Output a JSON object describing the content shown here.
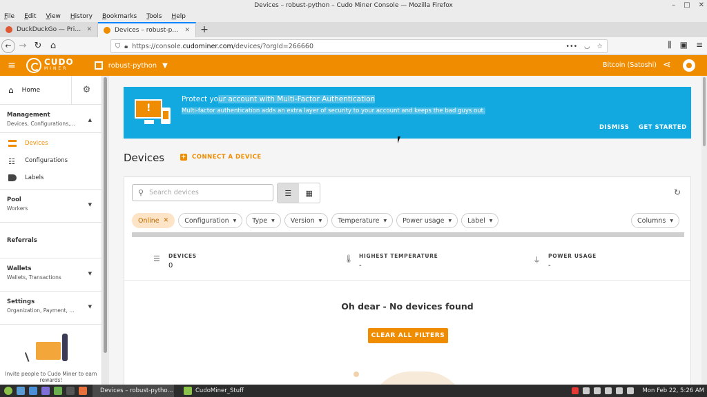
{
  "window": {
    "title": "Devices – robust-python – Cudo Miner Console — Mozilla Firefox",
    "controls": [
      "–",
      "□",
      "✕"
    ]
  },
  "menubar": [
    "File",
    "Edit",
    "View",
    "History",
    "Bookmarks",
    "Tools",
    "Help"
  ],
  "tabs": [
    {
      "label": "DuckDuckGo — Privacy, sim",
      "favicon_color": "#de5833",
      "active": false
    },
    {
      "label": "Devices – robust-python – C",
      "favicon_color": "#f08c00",
      "active": true
    }
  ],
  "navbar": {
    "url_prefix": "https://console.",
    "url_domain": "cudominer.com",
    "url_suffix": "/devices/?orgId=266660"
  },
  "app": {
    "brand": "CUDO",
    "brand_sub": "MINER",
    "org": "robust-python",
    "currency": "Bitcoin (Satoshi)"
  },
  "sidebar": {
    "home": "Home",
    "groups": [
      {
        "title": "Management",
        "subtitle": "Devices, Configurations,...",
        "expanded": true
      },
      {
        "title": "Pool",
        "subtitle": "Workers"
      },
      {
        "title": "Referrals",
        "subtitle": ""
      },
      {
        "title": "Wallets",
        "subtitle": "Wallets, Transactions"
      },
      {
        "title": "Settings",
        "subtitle": "Organization, Payment, ..."
      }
    ],
    "items": [
      {
        "label": "Devices",
        "active": true
      },
      {
        "label": "Configurations"
      },
      {
        "label": "Labels"
      }
    ],
    "promo": "Invite people to Cudo Miner to earn rewards!"
  },
  "banner": {
    "title_pre": "Protect yo",
    "title_sel": "ur account with Multi-Factor Authentication",
    "subtitle": "Multi-factor authentication adds an extra layer of security to your account and keeps the bad guys out.",
    "dismiss": "DISMISS",
    "get_started": "GET STARTED",
    "color": "#12a8e0"
  },
  "page": {
    "title": "Devices",
    "connect": "CONNECT A DEVICE"
  },
  "search": {
    "placeholder": "Search devices",
    "value": ""
  },
  "filters": {
    "active_chip": "Online",
    "chips": [
      "Configuration",
      "Type",
      "Version",
      "Temperature",
      "Power usage",
      "Label"
    ],
    "columns": "Columns"
  },
  "stats": [
    {
      "label": "DEVICES",
      "value": "0",
      "icon": "server-icon"
    },
    {
      "label": "HIGHEST TEMPERATURE",
      "value": "-",
      "icon": "thermometer-icon"
    },
    {
      "label": "POWER USAGE",
      "value": "-",
      "icon": "plug-icon"
    }
  ],
  "empty": {
    "message": "Oh dear - No devices found",
    "clear": "CLEAR ALL FILTERS"
  },
  "taskbar": {
    "tasks": [
      "Devices – robust-pytho...",
      "CudoMiner_Stuff"
    ],
    "clock": "Mon Feb 22,  5:26 AM"
  },
  "colors": {
    "accent": "#f08c00",
    "banner": "#12a8e0"
  }
}
